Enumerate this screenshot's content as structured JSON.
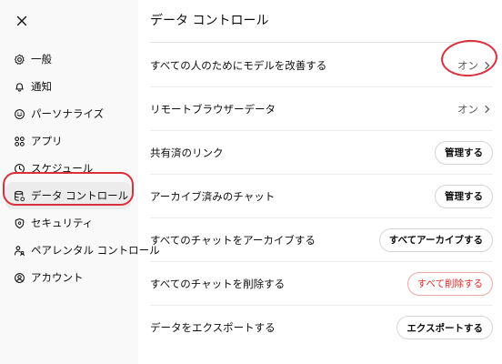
{
  "sidebar": {
    "close_label": "×",
    "items": [
      {
        "label": "一般",
        "icon": "gear-icon"
      },
      {
        "label": "通知",
        "icon": "bell-icon"
      },
      {
        "label": "パーソナライズ",
        "icon": "personalize-icon"
      },
      {
        "label": "アプリ",
        "icon": "apps-icon"
      },
      {
        "label": "スケジュール",
        "icon": "clock-icon"
      },
      {
        "label": "データ コントロール",
        "icon": "database-icon",
        "active": true
      },
      {
        "label": "セキュリティ",
        "icon": "shield-icon"
      },
      {
        "label": "ペアレンタル コントロール",
        "icon": "parent-icon"
      },
      {
        "label": "アカウント",
        "icon": "account-icon"
      }
    ]
  },
  "main": {
    "title": "データ コントロール",
    "rows": [
      {
        "label": "すべての人のためにモデルを改善する",
        "value": "オン"
      },
      {
        "label": "リモートブラウザーデータ",
        "value": "オン"
      },
      {
        "label": "共有済のリンク",
        "button": "管理する"
      },
      {
        "label": "アーカイブ済みのチャット",
        "button": "管理する"
      },
      {
        "label": "すべてのチャットをアーカイブする",
        "button": "すべてアーカイブする"
      },
      {
        "label": "すべてのチャットを削除する",
        "button": "すべて削除する"
      },
      {
        "label": "データをエクスポートする",
        "button": "エクスポートする"
      }
    ]
  },
  "colors": {
    "annotation": "#d9303b",
    "danger": "#e02e2a",
    "sidebar_bg": "#f9f9f9",
    "active_bg": "#ececec"
  }
}
